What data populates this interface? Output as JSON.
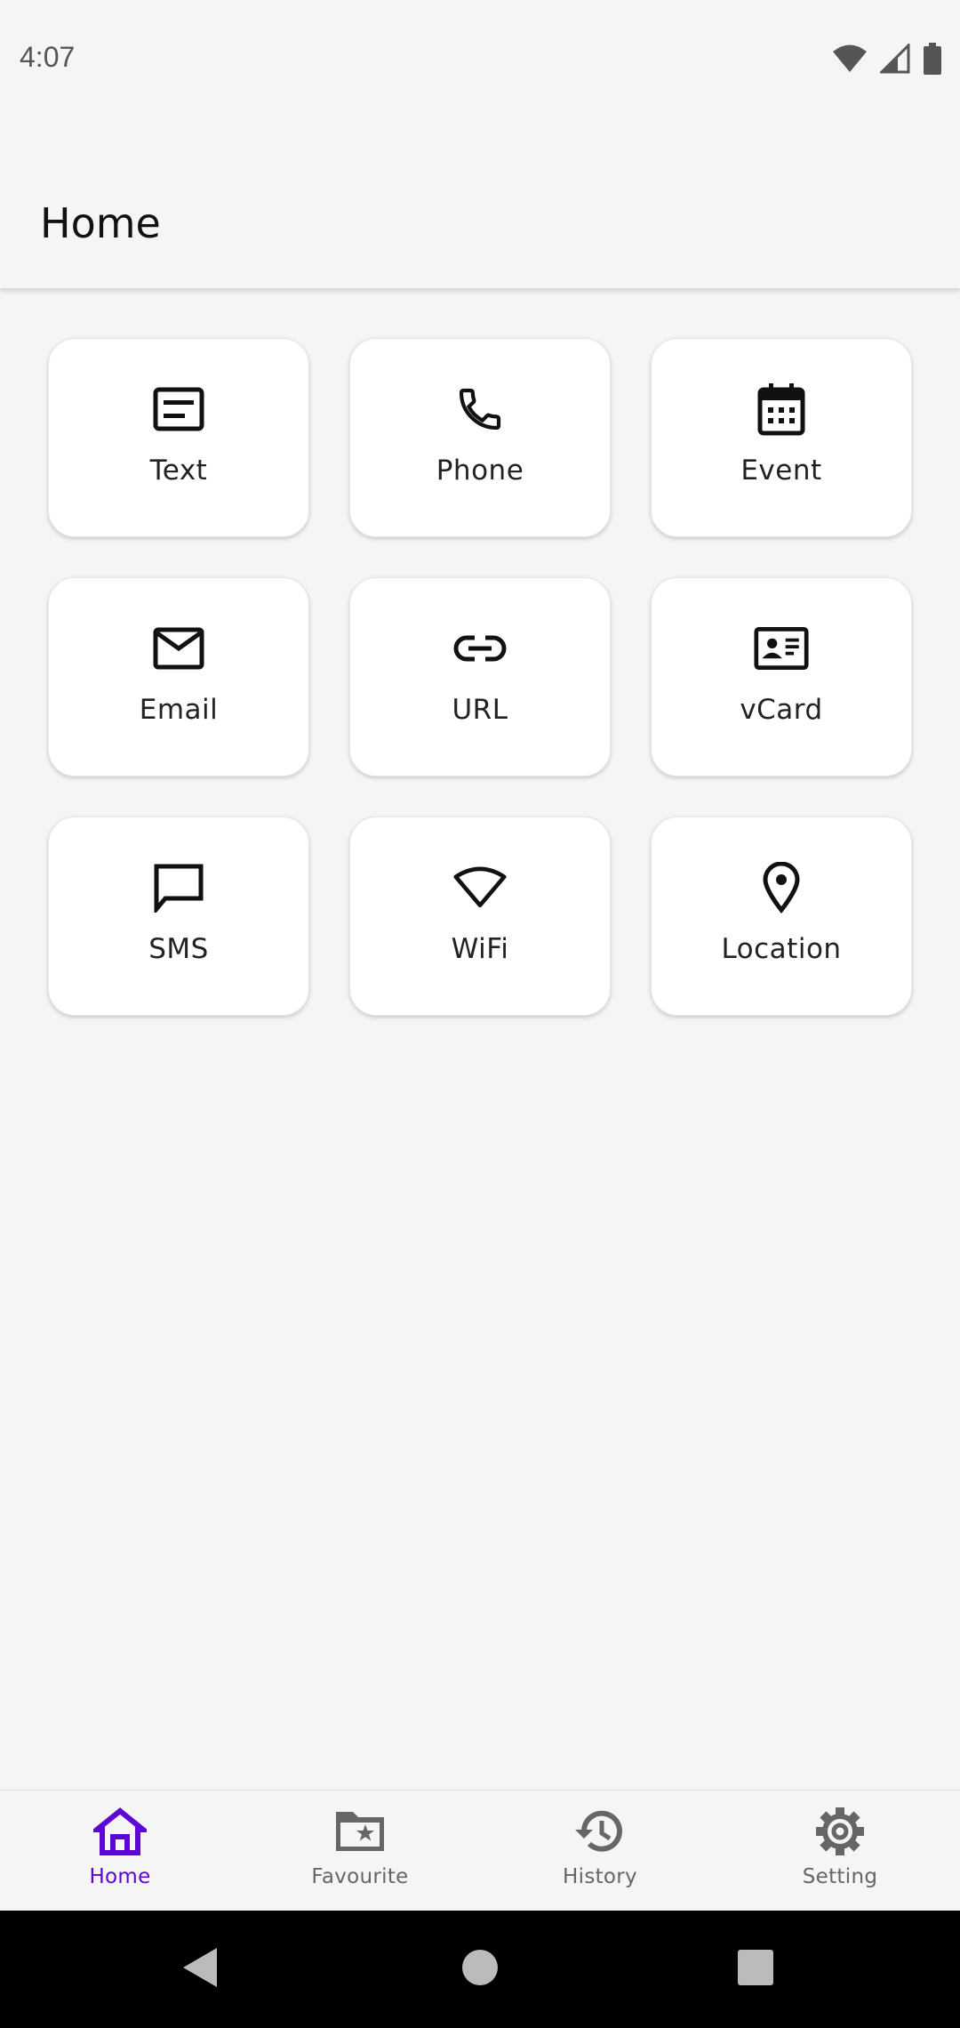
{
  "status_bar": {
    "time": "4:07",
    "icons": [
      "wifi-icon",
      "cell-signal-icon",
      "battery-icon"
    ]
  },
  "app_bar": {
    "title": "Home"
  },
  "tiles": [
    {
      "label": "Text",
      "icon": "text-icon"
    },
    {
      "label": "Phone",
      "icon": "phone-icon"
    },
    {
      "label": "Event",
      "icon": "calendar-icon"
    },
    {
      "label": "Email",
      "icon": "email-icon"
    },
    {
      "label": "URL",
      "icon": "link-icon"
    },
    {
      "label": "vCard",
      "icon": "contact-card-icon"
    },
    {
      "label": "SMS",
      "icon": "chat-icon"
    },
    {
      "label": "WiFi",
      "icon": "wifi-icon"
    },
    {
      "label": "Location",
      "icon": "location-pin-icon"
    }
  ],
  "bottom_nav": {
    "items": [
      {
        "label": "Home",
        "icon": "home-icon",
        "active": true
      },
      {
        "label": "Favourite",
        "icon": "star-folder-icon",
        "active": false
      },
      {
        "label": "History",
        "icon": "history-icon",
        "active": false
      },
      {
        "label": "Setting",
        "icon": "gear-icon",
        "active": false
      }
    ]
  },
  "colors": {
    "accent": "#5b06d4",
    "background": "#f5f5f5",
    "tile": "#ffffff",
    "inactive": "#666666"
  }
}
